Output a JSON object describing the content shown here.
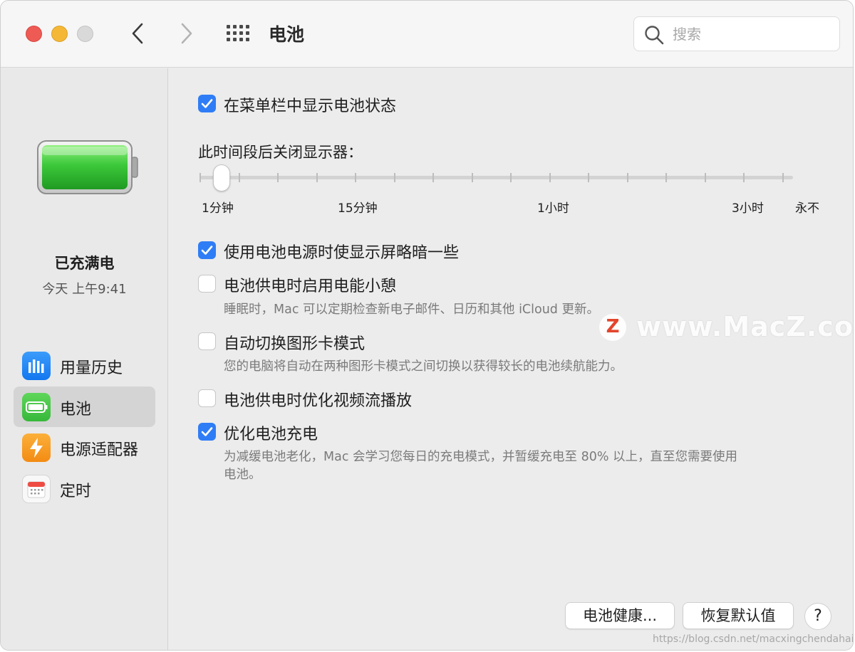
{
  "window": {
    "title": "电池",
    "search_placeholder": "搜索"
  },
  "sidebar": {
    "status_main": "已充满电",
    "status_sub": "今天 上午9:41",
    "items": [
      {
        "label": "用量历史",
        "icon": "bar-chart-icon",
        "selected": false
      },
      {
        "label": "电池",
        "icon": "battery-icon",
        "selected": true
      },
      {
        "label": "电源适配器",
        "icon": "lightning-icon",
        "selected": false
      },
      {
        "label": "定时",
        "icon": "calendar-icon",
        "selected": false
      }
    ]
  },
  "options": {
    "show_in_menubar": {
      "label": "在菜单栏中显示电池状态",
      "checked": true
    },
    "slider": {
      "title": "此时间段后关闭显示器：",
      "labels": [
        "1分钟",
        "15分钟",
        "1小时",
        "3小时",
        "永不"
      ],
      "value": "1分钟"
    },
    "dim_display": {
      "label": "使用电池电源时使显示屏略暗一些",
      "checked": true
    },
    "power_nap": {
      "label": "电池供电时启用电能小憩",
      "desc": "睡眠时，Mac 可以定期检查新电子邮件、日历和其他 iCloud 更新。",
      "checked": false
    },
    "auto_graphics": {
      "label": "自动切换图形卡模式",
      "desc": "您的电脑将自动在两种图形卡模式之间切换以获得较长的电池续航能力。",
      "checked": false
    },
    "optimize_video": {
      "label": "电池供电时优化视频流播放",
      "checked": false
    },
    "optimize_charging": {
      "label": "优化电池充电",
      "desc_line1": "为减缓电池老化，Mac 会学习您每日的充电模式，并暂缓充电至 80% 以上，直至您需要使用",
      "desc_line2": "电池。",
      "checked": true
    }
  },
  "buttons": {
    "battery_health": "电池健康...",
    "restore_defaults": "恢复默认值",
    "help": "?"
  },
  "watermark": {
    "logo_letter": "Z",
    "text": "www.MacZ.com",
    "url": "https://blog.csdn.net/macxingchendahai"
  },
  "colors": {
    "accent": "#2f7df6",
    "close": "#ee5b55",
    "minimize": "#f5b836",
    "zoom_disabled": "#d9d9d9",
    "battery_green": "#3cc83a"
  }
}
